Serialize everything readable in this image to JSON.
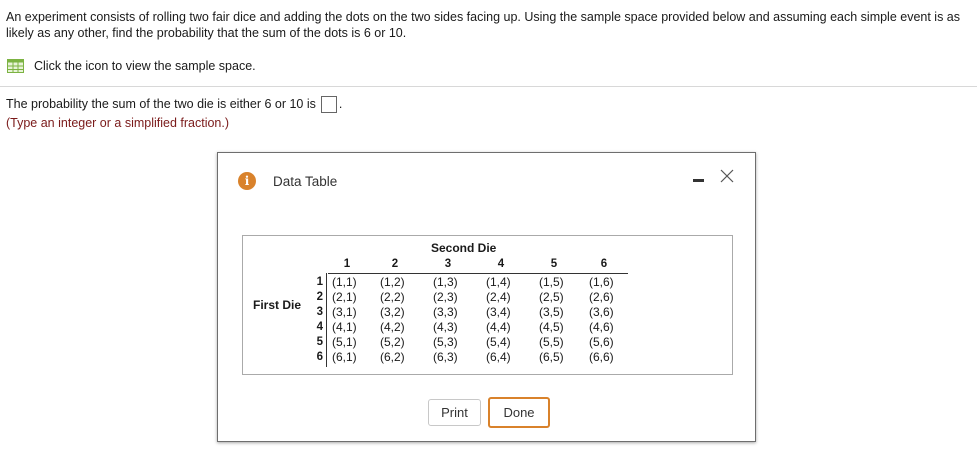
{
  "question": {
    "text": "An experiment consists of rolling two fair dice and adding the dots on the two sides facing up. Using the sample space provided below and assuming each simple event is as likely as any other, find the probability that the sum of the dots is 6 or 10.",
    "icon_link": "Click the icon to view the sample space.",
    "answer_prefix": "The probability the sum of the two die is either 6 or 10 is",
    "answer_suffix": ".",
    "hint": "(Type an integer or a simplified fraction.)",
    "answer_value": ""
  },
  "dialog": {
    "title": "Data Table",
    "minimize_icon": "minimize-icon",
    "close_icon": "close-icon",
    "table": {
      "second_die_label": "Second Die",
      "first_die_label": "First Die",
      "columns": [
        "1",
        "2",
        "3",
        "4",
        "5",
        "6"
      ],
      "rows": [
        {
          "label": "1",
          "cells": [
            "(1,1)",
            "(1,2)",
            "(1,3)",
            "(1,4)",
            "(1,5)",
            "(1,6)"
          ]
        },
        {
          "label": "2",
          "cells": [
            "(2,1)",
            "(2,2)",
            "(2,3)",
            "(2,4)",
            "(2,5)",
            "(2,6)"
          ]
        },
        {
          "label": "3",
          "cells": [
            "(3,1)",
            "(3,2)",
            "(3,3)",
            "(3,4)",
            "(3,5)",
            "(3,6)"
          ]
        },
        {
          "label": "4",
          "cells": [
            "(4,1)",
            "(4,2)",
            "(4,3)",
            "(4,4)",
            "(4,5)",
            "(4,6)"
          ]
        },
        {
          "label": "5",
          "cells": [
            "(5,1)",
            "(5,2)",
            "(5,3)",
            "(5,4)",
            "(5,5)",
            "(5,6)"
          ]
        },
        {
          "label": "6",
          "cells": [
            "(6,1)",
            "(6,2)",
            "(6,3)",
            "(6,4)",
            "(6,5)",
            "(6,6)"
          ]
        }
      ]
    },
    "print_label": "Print",
    "done_label": "Done"
  },
  "colors": {
    "accent_orange": "#d9822b",
    "hint_text": "#7a1a1a",
    "table_icon_green": "#7cb342"
  }
}
